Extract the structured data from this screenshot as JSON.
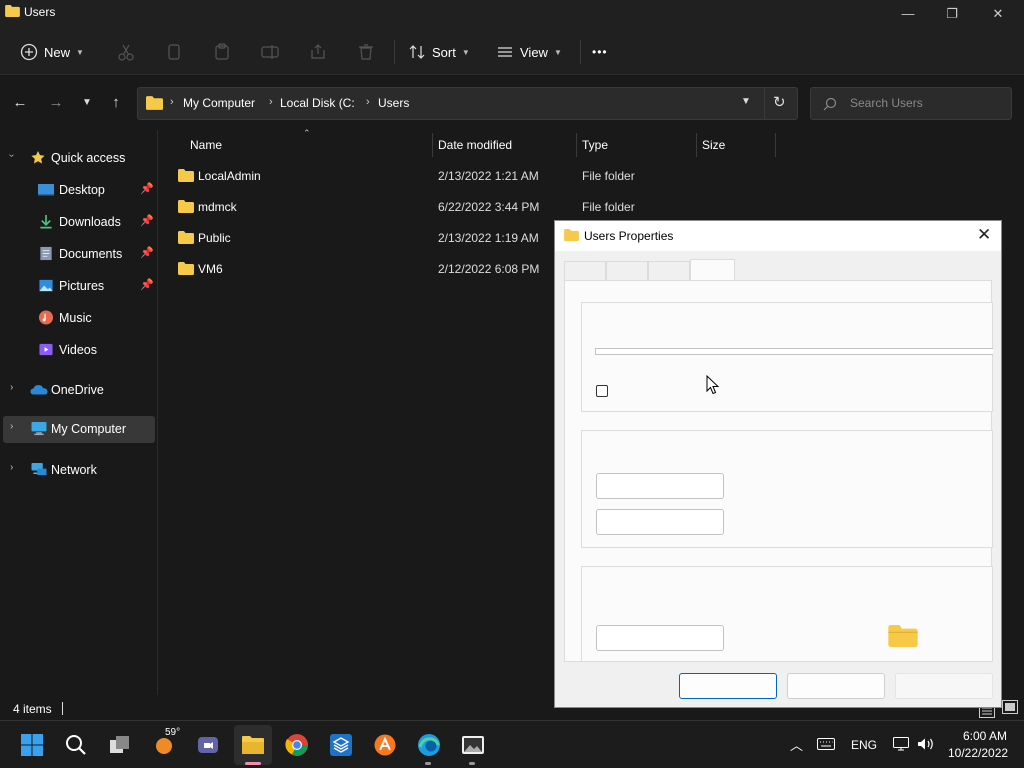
{
  "window": {
    "title": "Users",
    "minimize_glyph": "—",
    "maximize_glyph": "❐",
    "close_glyph": "✕"
  },
  "toolbar": {
    "new_label": "New",
    "sort_label": "Sort",
    "view_label": "View",
    "more_glyph": "•••"
  },
  "address": {
    "crumbs": [
      "My Computer",
      "Local Disk (C:",
      "Users"
    ],
    "search_placeholder": "Search Users"
  },
  "sidebar": {
    "items": [
      {
        "label": "Quick access",
        "icon": "star-icon"
      },
      {
        "label": "Desktop",
        "icon": "desktop-icon",
        "pinned": true
      },
      {
        "label": "Downloads",
        "icon": "download-icon",
        "pinned": true
      },
      {
        "label": "Documents",
        "icon": "documents-icon",
        "pinned": true
      },
      {
        "label": "Pictures",
        "icon": "pictures-icon",
        "pinned": true
      },
      {
        "label": "Music",
        "icon": "music-icon"
      },
      {
        "label": "Videos",
        "icon": "videos-icon"
      },
      {
        "label": "OneDrive",
        "icon": "cloud-icon"
      },
      {
        "label": "My Computer",
        "icon": "computer-icon",
        "selected": true
      },
      {
        "label": "Network",
        "icon": "network-icon"
      }
    ]
  },
  "filelist": {
    "columns": [
      "Name",
      "Date modified",
      "Type",
      "Size"
    ],
    "rows": [
      {
        "name": "LocalAdmin",
        "date": "2/13/2022 1:21 AM",
        "type": "File folder"
      },
      {
        "name": "mdmck",
        "date": "6/22/2022 3:44 PM",
        "type": "File folder"
      },
      {
        "name": "Public",
        "date": "2/13/2022 1:19 AM",
        "type": ""
      },
      {
        "name": "VM6",
        "date": "2/12/2022 6:08 PM",
        "type": ""
      }
    ]
  },
  "status": {
    "item_count": "4 items"
  },
  "dialog": {
    "title": "Users Properties"
  },
  "taskbar": {
    "weather_temp": "59°",
    "language": "ENG",
    "time": "6:00 AM",
    "date": "10/22/2022"
  },
  "colors": {
    "folder": "#f7c948",
    "accent": "#0067c0",
    "explorer_bg": "#191919"
  }
}
